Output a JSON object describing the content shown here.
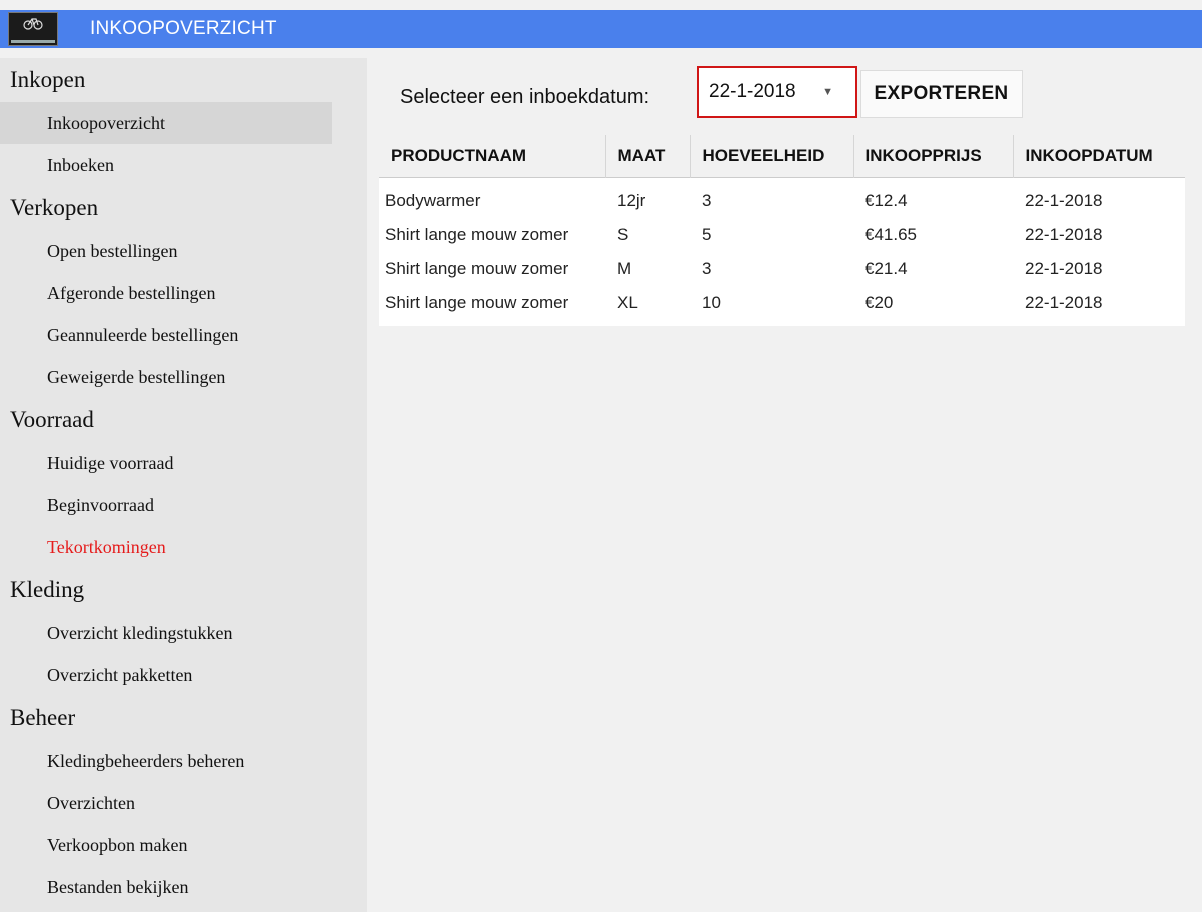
{
  "titlebar": {
    "title": "INKOOPOVERZICHT",
    "logo_icon": "bicycle-icon",
    "color": "#4a80ec"
  },
  "sidebar": {
    "sections": [
      {
        "title": "Inkopen",
        "items": [
          "Inkoopoverzicht",
          "Inboeken"
        ]
      },
      {
        "title": "Verkopen",
        "items": [
          "Open bestellingen",
          "Afgeronde bestellingen",
          "Geannuleerde bestellingen",
          "Geweigerde bestellingen"
        ]
      },
      {
        "title": "Voorraad",
        "items": [
          "Huidige voorraad",
          "Beginvoorraad",
          "Tekortkomingen"
        ]
      },
      {
        "title": "Kleding",
        "items": [
          "Overzicht kledingstukken",
          "Overzicht pakketten"
        ]
      },
      {
        "title": "Beheer",
        "items": [
          "Kledingbeheerders beheren",
          "Overzichten",
          "Verkoopbon maken",
          "Bestanden bekijken"
        ]
      }
    ],
    "active_item": "Inkoopoverzicht",
    "alert_item": "Tekortkomingen",
    "alert_color": "#e51c1c"
  },
  "toolbar": {
    "label": "Selecteer een inboekdatum:",
    "date_value": "22-1-2018",
    "export_label": "EXPORTEREN",
    "highlight_color": "#d01616"
  },
  "table": {
    "columns": [
      "PRODUCTNAAM",
      "MAAT",
      "HOEVEELHEID",
      "INKOOPPRIJS",
      "INKOOPDATUM"
    ],
    "rows": [
      [
        "Bodywarmer",
        "12jr",
        "3",
        "€12.4",
        "22-1-2018"
      ],
      [
        "Shirt lange mouw zomer",
        "S",
        "5",
        "€41.65",
        "22-1-2018"
      ],
      [
        "Shirt lange mouw zomer",
        "M",
        "3",
        "€21.4",
        "22-1-2018"
      ],
      [
        "Shirt lange mouw zomer",
        "XL",
        "10",
        "€20",
        "22-1-2018"
      ]
    ]
  }
}
